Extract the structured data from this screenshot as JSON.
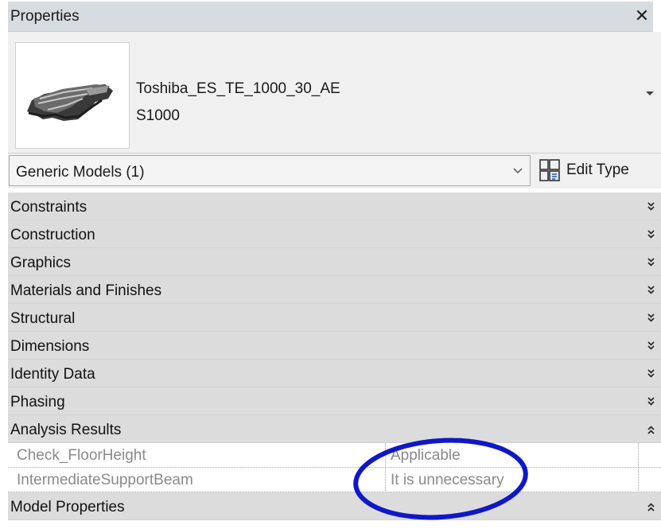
{
  "panel": {
    "title": "Properties",
    "close_symbol": "✕"
  },
  "type_selector": {
    "family": "Toshiba_ES_TE_1000_30_AE",
    "type": "S1000",
    "thumbnail_icon": "escalator-thumbnail"
  },
  "instance_selector": {
    "value": "Generic Models (1)",
    "edit_type_label": "Edit Type",
    "edit_type_icon": "edit-type-icon"
  },
  "groups": [
    {
      "label": "Constraints",
      "expanded": false
    },
    {
      "label": "Construction",
      "expanded": false
    },
    {
      "label": "Graphics",
      "expanded": false
    },
    {
      "label": "Materials and Finishes",
      "expanded": false
    },
    {
      "label": "Structural",
      "expanded": false
    },
    {
      "label": "Dimensions",
      "expanded": false
    },
    {
      "label": "Identity Data",
      "expanded": false
    },
    {
      "label": "Phasing",
      "expanded": false
    },
    {
      "label": "Analysis Results",
      "expanded": true
    },
    {
      "label": "Model Properties",
      "expanded": true
    }
  ],
  "analysis_results": [
    {
      "name": "Check_FloorHeight",
      "value": "Applicable"
    },
    {
      "name": "IntermediateSupportBeam",
      "value": "It is unnecessary"
    }
  ],
  "colors": {
    "group_header_bg": "#dcdcdc",
    "annotation_ellipse": "#1017c8",
    "readonly_text": "#8a8a8a"
  }
}
